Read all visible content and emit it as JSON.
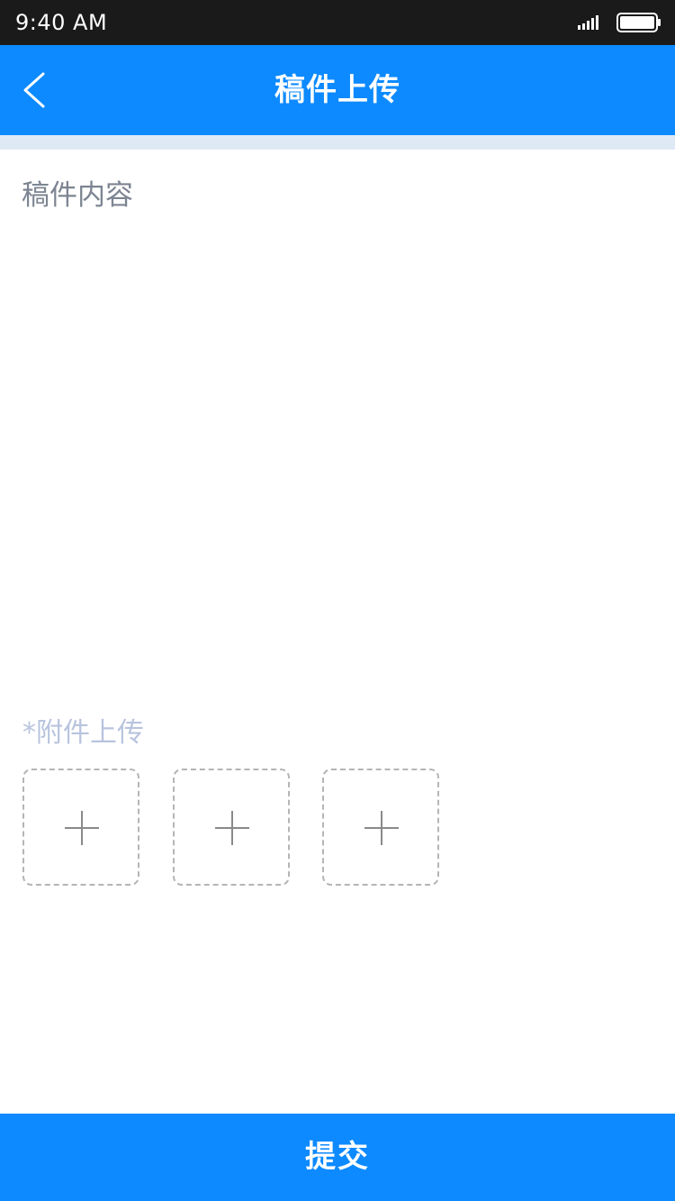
{
  "status_bar": {
    "time": "9:40 AM"
  },
  "nav": {
    "title": "稿件上传",
    "back_icon": "chevron-left-icon"
  },
  "content": {
    "placeholder": "稿件内容",
    "value": ""
  },
  "attachments": {
    "label": "*附件上传",
    "slots": [
      {
        "icon": "plus-icon"
      },
      {
        "icon": "plus-icon"
      },
      {
        "icon": "plus-icon"
      }
    ]
  },
  "submit": {
    "label": "提交"
  },
  "colors": {
    "accent": "#0d8aff",
    "status_bar": "#1a1a1a",
    "divider": "#dfe9f5",
    "placeholder": "#7d8592",
    "attach_label": "#b8c4de",
    "dashed_border": "#b5b5b5"
  }
}
